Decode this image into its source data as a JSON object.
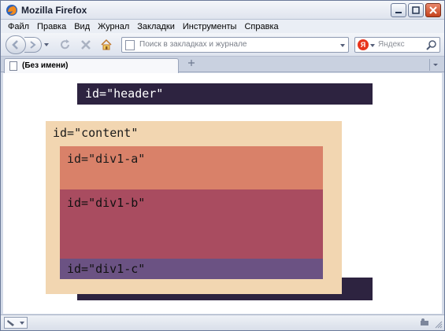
{
  "window": {
    "title": "Mozilla Firefox"
  },
  "menu": [
    {
      "label": "Файл"
    },
    {
      "label": "Правка"
    },
    {
      "label": "Вид"
    },
    {
      "label": "Журнал"
    },
    {
      "label": "Закладки"
    },
    {
      "label": "Инструменты"
    },
    {
      "label": "Справка"
    }
  ],
  "nav": {
    "url_placeholder": "Поиск в закладках и журнале",
    "search_placeholder": "Яндекс",
    "search_engine_letter": "Я"
  },
  "tabs": [
    {
      "label": "(Без имени)"
    }
  ],
  "page": {
    "header_text": "id=\"header\"",
    "content_text": "id=\"content\"",
    "div_a_text": "id=\"div1-a\"",
    "div_b_text": "id=\"div1-b\"",
    "div_c_text": "id=\"div1-c\""
  },
  "colors": {
    "header": "#2d2340",
    "content": "#f2d6b1",
    "div_a": "#d98169",
    "div_b": "#a94c60",
    "div_c": "#6b5283"
  },
  "icons": [
    "firefox-logo-icon",
    "back-icon",
    "forward-icon",
    "reload-icon",
    "stop-icon",
    "home-icon",
    "search-icon",
    "new-tab-icon",
    "addon-icon"
  ]
}
